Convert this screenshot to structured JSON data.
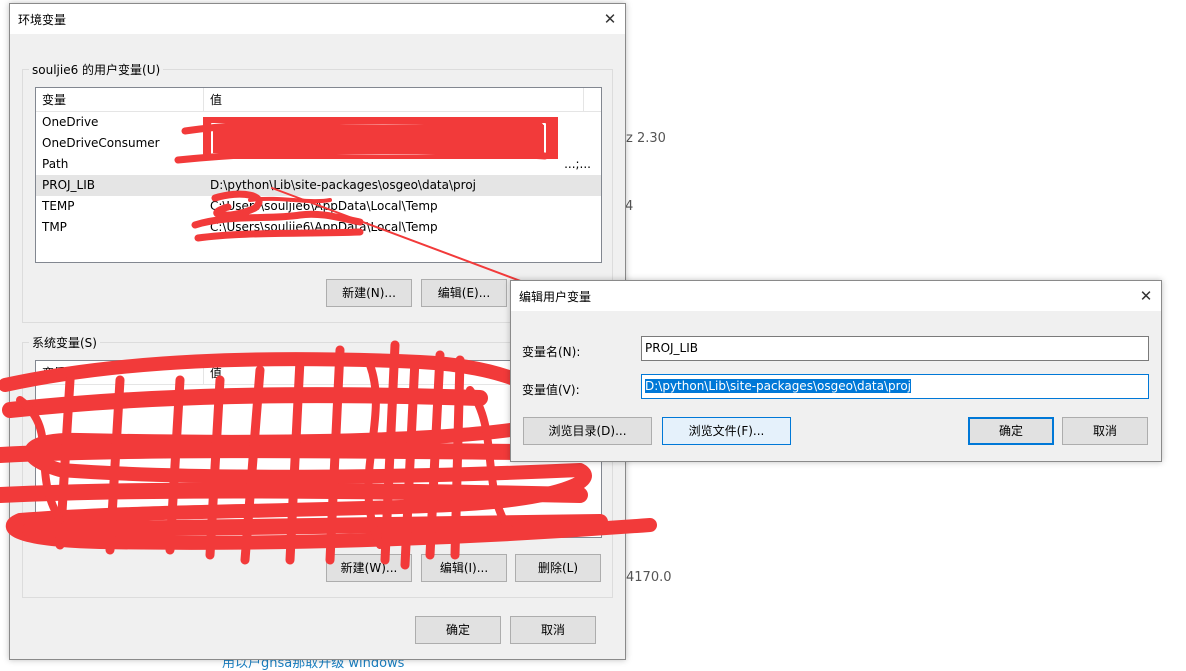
{
  "background": {
    "text_1": "z  2.30",
    "text_2": "4",
    "text_3": "4170.0",
    "link": "用以户gnsa那取开级 windows"
  },
  "env_dialog": {
    "title": "环境变量",
    "user_group_label": "souljie6 的用户变量(U)",
    "columns": [
      "变量",
      "值"
    ],
    "user_vars": [
      {
        "name": "OneDrive",
        "value": ""
      },
      {
        "name": "OneDriveConsumer",
        "value": ""
      },
      {
        "name": "Path",
        "value": "...;..."
      },
      {
        "name": "PROJ_LIB",
        "value": "D:\\python\\Lib\\site-packages\\osgeo\\data\\proj"
      },
      {
        "name": "TEMP",
        "value": "C:\\Users\\souljie6\\AppData\\Local\\Temp"
      },
      {
        "name": "TMP",
        "value": "C:\\Users\\souljie6\\AppData\\Local\\Temp"
      }
    ],
    "user_buttons": {
      "new": "新建(N)...",
      "edit": "编辑(E)..."
    },
    "system_group_label": "系统变量(S)",
    "system_buttons": {
      "new": "新建(W)...",
      "edit": "编辑(I)...",
      "delete": "删除(L)"
    },
    "ok": "确定",
    "cancel": "取消"
  },
  "edit_dialog": {
    "title": "编辑用户变量",
    "name_label": "变量名(N):",
    "name_value": "PROJ_LIB",
    "value_label": "变量值(V):",
    "value_value": "D:\\python\\Lib\\site-packages\\osgeo\\data\\proj",
    "browse_dir": "浏览目录(D)...",
    "browse_file": "浏览文件(F)...",
    "ok": "确定",
    "cancel": "取消"
  },
  "colors": {
    "redaction": "#f23a3a",
    "selection": "#0078d7"
  }
}
